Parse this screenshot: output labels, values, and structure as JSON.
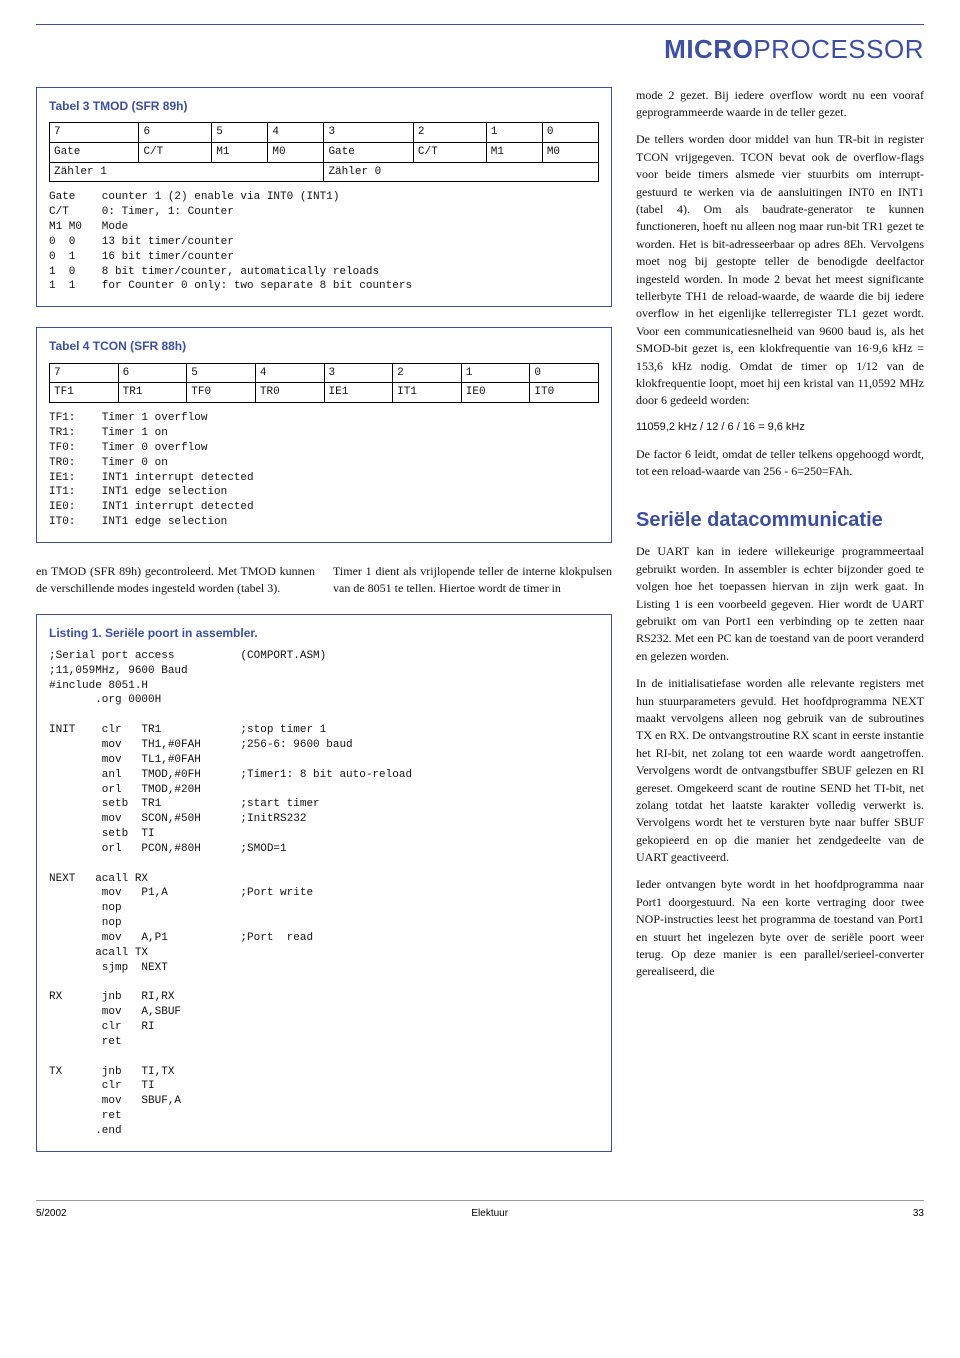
{
  "header": {
    "left": "MICRO",
    "right": "PROCESSOR"
  },
  "tabel3": {
    "title": "Tabel 3  TMOD (SFR 89h)",
    "bits": [
      "7",
      "6",
      "5",
      "4",
      "3",
      "2",
      "1",
      "0"
    ],
    "row2": [
      "Gate",
      "C/T",
      "M1",
      "M0",
      "Gate",
      "C/T",
      "M1",
      "M0"
    ],
    "ax_left": "Zähler 1",
    "ax_right": "Zähler 0",
    "desc": "Gate    counter 1 (2) enable via INT0 (INT1)\nC/T     0: Timer, 1: Counter\nM1 M0   Mode\n0  0    13 bit timer/counter\n0  1    16 bit timer/counter\n1  0    8 bit timer/counter, automatically reloads\n1  1    for Counter 0 only: two separate 8 bit counters"
  },
  "tabel4": {
    "title": "Tabel 4         TCON (SFR 88h)",
    "bits": [
      "7",
      "6",
      "5",
      "4",
      "3",
      "2",
      "1",
      "0"
    ],
    "row2": [
      "TF1",
      "TR1",
      "TF0",
      "TR0",
      "IE1",
      "IT1",
      "IE0",
      "IT0"
    ],
    "desc": "TF1:    Timer 1 overflow\nTR1:    Timer 1 on\nTF0:    Timer 0 overflow\nTR0:    Timer 0 on\nIE1:    INT1 interrupt detected\nIT1:    INT1 edge selection\nIE0:    INT1 interrupt detected\nIT0:    INT1 edge selection"
  },
  "mid_left": "en TMOD (SFR 89h) gecontroleerd. Met TMOD kunnen de verschillende modes ingesteld worden (tabel 3).",
  "mid_right": "Timer 1 dient als vrijlopende teller de interne klokpulsen van de 8051 te tellen. Hiertoe wordt de timer in",
  "listing": {
    "title": "Listing 1. Seriële poort in assembler.",
    "code": ";Serial port access          (COMPORT.ASM)\n;11,059MHz, 9600 Baud\n#include 8051.H\n       .org 0000H\n\nINIT    clr   TR1            ;stop timer 1\n        mov   TH1,#0FAH      ;256-6: 9600 baud\n        mov   TL1,#0FAH\n        anl   TMOD,#0FH      ;Timer1: 8 bit auto-reload\n        orl   TMOD,#20H\n        setb  TR1            ;start timer\n        mov   SCON,#50H      ;InitRS232\n        setb  TI\n        orl   PCON,#80H      ;SMOD=1\n\nNEXT   acall RX\n        mov   P1,A           ;Port write\n        nop\n        nop\n        mov   A,P1           ;Port  read\n       acall TX\n        sjmp  NEXT\n\nRX      jnb   RI,RX\n        mov   A,SBUF\n        clr   RI\n        ret\n\nTX      jnb   TI,TX\n        clr   TI\n        mov   SBUF,A\n        ret\n       .end"
  },
  "right_p1": "mode 2 gezet. Bij iedere overflow wordt nu een vooraf geprogrammeerde waarde in de teller gezet.",
  "right_p2": "De tellers worden door middel van hun TR-bit in register TCON vrijgegeven. TCON bevat ook de overflow-flags voor beide timers alsmede vier stuurbits om interrupt-gestuurd te werken via de aansluitingen INT0 en INT1 (tabel 4). Om als baudrate-generator te kunnen functioneren, hoeft nu alleen nog maar run-bit TR1 gezet te worden. Het is bit-adresseerbaar op adres 8Eh. Vervolgens moet nog bij gestopte teller de benodigde deelfactor ingesteld worden. In mode 2 bevat het meest significante tellerbyte TH1 de reload-waarde, de waarde die bij iedere overflow in het eigenlijke tellerregister TL1 gezet wordt. Voor een communicatiesnelheid van 9600 baud is, als het SMOD-bit gezet is, een klokfrequentie van 16·9,6 kHz = 153,6 kHz nodig. Omdat de timer op 1/12 van de klokfrequentie loopt, moet hij een kristal van 11,0592 MHz door 6 gedeeld worden:",
  "right_eq": "11059,2 kHz / 12 / 6 / 16 = 9,6 kHz",
  "right_p3": "De factor 6 leidt, omdat de teller telkens opgehoogd wordt, tot een reload-waarde van 256 - 6=250=FAh.",
  "right_h": "Seriële datacommunicatie",
  "right_p4": "De UART kan in iedere willekeurige programmeertaal gebruikt worden. In assembler is echter bijzonder goed te volgen hoe het toepassen hiervan in zijn werk gaat. In Listing 1 is een voorbeeld gegeven. Hier wordt de UART gebruikt om van Port1 een verbinding op te zetten naar RS232. Met een PC kan de toestand van de poort veranderd en gelezen worden.",
  "right_p5": "In de initialisatiefase worden alle relevante registers met hun stuurparameters gevuld. Het hoofdprogramma NEXT maakt vervolgens alleen nog gebruik van de subroutines TX en RX. De ontvangstroutine RX scant in eerste instantie het RI-bit, net zolang tot een waarde wordt aangetroffen. Vervolgens wordt de ontvangstbuffer SBUF gelezen en RI gereset. Omgekeerd scant de routine SEND het TI-bit, net zolang totdat het laatste karakter volledig verwerkt is. Vervolgens wordt het te versturen byte naar buffer SBUF gekopieerd en op die manier het zendgedeelte van de UART geactiveerd.",
  "right_p6": "Ieder ontvangen byte wordt in het hoofdprogramma naar Port1 doorgestuurd. Na een korte vertraging door twee NOP-instructies leest het programma de toestand van Port1 en stuurt het ingelezen byte over de seriële poort weer terug. Op deze manier is een parallel/serieel-converter gerealiseerd, die",
  "footer": {
    "left": "5/2002",
    "center": "Elektuur",
    "right": "33"
  }
}
